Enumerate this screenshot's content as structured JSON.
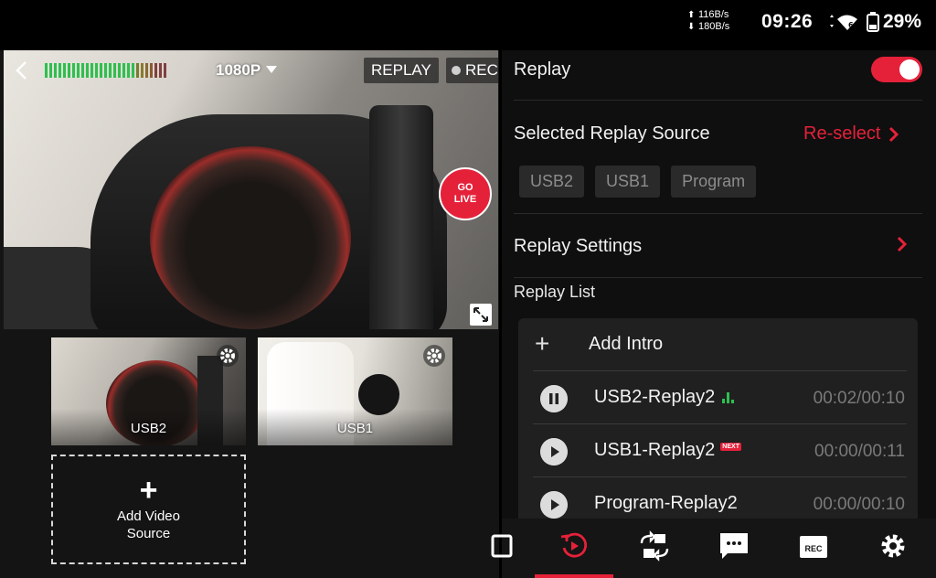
{
  "status_bar": {
    "net_up": "116B/s",
    "net_down": "180B/s",
    "clock": "09:26",
    "battery": "29%"
  },
  "preview": {
    "resolution": "1080P",
    "replay_badge": "REPLAY",
    "rec_badge": "REC",
    "go_live_line1": "GO",
    "go_live_line2": "LIVE"
  },
  "sources": [
    {
      "label": "USB2"
    },
    {
      "label": "USB1"
    }
  ],
  "add_source": {
    "line1": "Add Video",
    "line2": "Source"
  },
  "replay_panel": {
    "replay_label": "Replay",
    "replay_enabled": true,
    "selected_source_label": "Selected Replay Source",
    "reselect_label": "Re-select",
    "chips": [
      "USB2",
      "USB1",
      "Program"
    ],
    "settings_label": "Replay Settings",
    "list_title": "Replay List",
    "add_intro": "Add Intro",
    "items": [
      {
        "name": "USB2-Replay2",
        "time": "00:02/00:10",
        "state": "playing"
      },
      {
        "name": "USB1-Replay2",
        "time": "00:00/00:11",
        "state": "paused",
        "badge": "NEXT"
      },
      {
        "name": "Program-Replay2",
        "time": "00:00/00:10",
        "state": "paused"
      }
    ]
  },
  "colors": {
    "accent": "#e5213a",
    "level_green": "#2fbf4f"
  },
  "tabbar": {
    "active": "replay",
    "tabs": [
      "layout",
      "replay",
      "switch-camera",
      "comments",
      "rec",
      "settings"
    ]
  }
}
